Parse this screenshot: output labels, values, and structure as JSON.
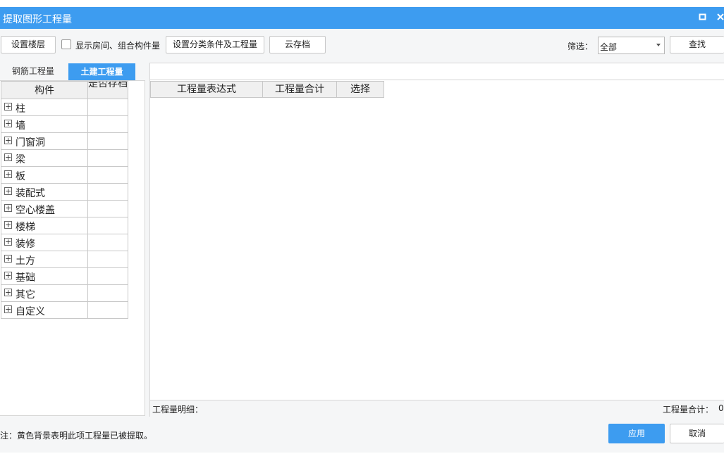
{
  "window": {
    "title": "提取图形工程量",
    "maximize_icon": "maximize-icon",
    "close_icon": "close-icon"
  },
  "toolbar": {
    "set_floor_label": "设置楼层",
    "show_rooms_label": "显示房间、组合构件量",
    "show_rooms_checked": false,
    "set_classification_label": "设置分类条件及工程量",
    "cloud_archive_label": "云存档",
    "filter_label": "筛选：",
    "filter_value": "全部",
    "find_label": "查找"
  },
  "tabs": [
    {
      "label": "钢筋工程量",
      "active": false
    },
    {
      "label": "土建工程量",
      "active": true
    }
  ],
  "tree": {
    "col_component": "构件",
    "col_archived": "是否存档",
    "items": [
      {
        "label": "柱"
      },
      {
        "label": "墙"
      },
      {
        "label": "门窗洞"
      },
      {
        "label": "梁"
      },
      {
        "label": "板"
      },
      {
        "label": "装配式"
      },
      {
        "label": "空心楼盖"
      },
      {
        "label": "楼梯"
      },
      {
        "label": "装修"
      },
      {
        "label": "土方"
      },
      {
        "label": "基础"
      },
      {
        "label": "其它"
      },
      {
        "label": "自定义"
      }
    ]
  },
  "grid": {
    "columns": [
      "工程量表达式",
      "工程量合计",
      "选择"
    ],
    "detail_label": "工程量明细：",
    "total_label": "工程量合计：",
    "total_value": "0"
  },
  "footer": {
    "note": "注：黄色背景表明此项工程量已被提取。",
    "apply_label": "应用",
    "cancel_label": "取消"
  },
  "colors": {
    "accent": "#3d9cf0",
    "titlebar": "#3d9cf0"
  }
}
